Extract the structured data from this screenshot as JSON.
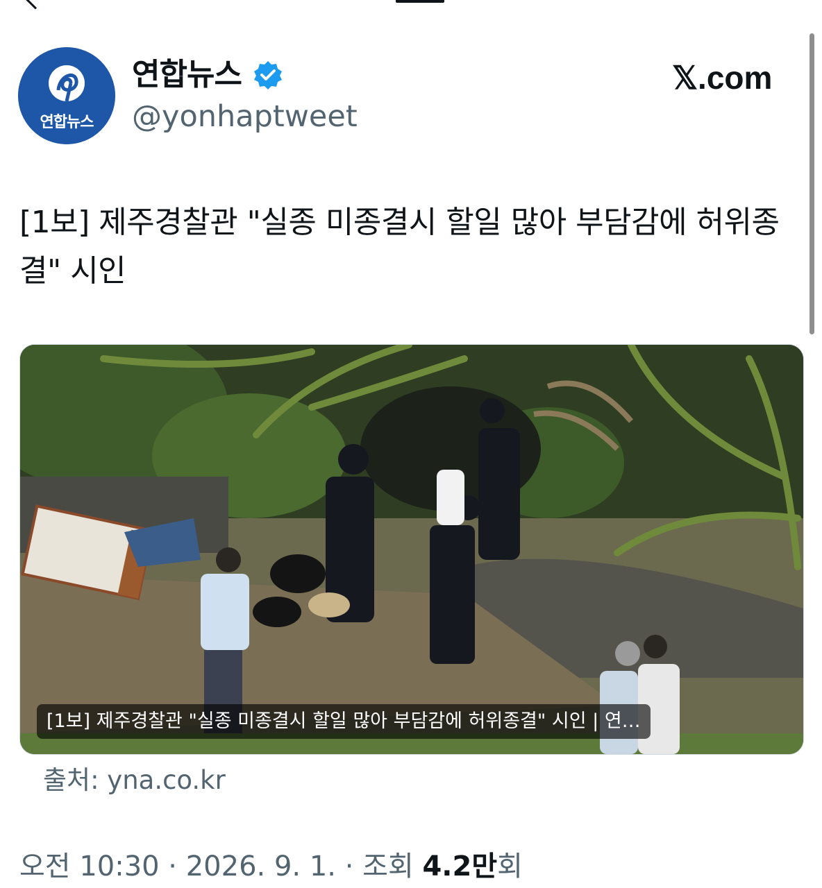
{
  "account": {
    "name": "연합뉴스",
    "handle": "@yonhaptweet",
    "avatar_label": "연합뉴스",
    "verified_icon": "verified-badge-icon",
    "platform_logo": "𝕏.com"
  },
  "tweet": {
    "text": "[1보] 제주경찰관 \"실종 미종결시 할일 많아 부담감에 허위종결\" 시인",
    "media_caption": "[1보] 제주경찰관 \"실종 미종결시 할일 많아 부담감에 허위종결\" 시인 | 연…",
    "source": "출처: yna.co.kr",
    "time": "오전 10:30 · 2026. 9. 1. · 조회 ",
    "views": "4.2만",
    "views_suffix": "회"
  },
  "colors": {
    "avatar_bg": "#1f57a8",
    "verified": "#1d9bf0",
    "secondary_text": "#536471",
    "primary_text": "#0f1419"
  }
}
